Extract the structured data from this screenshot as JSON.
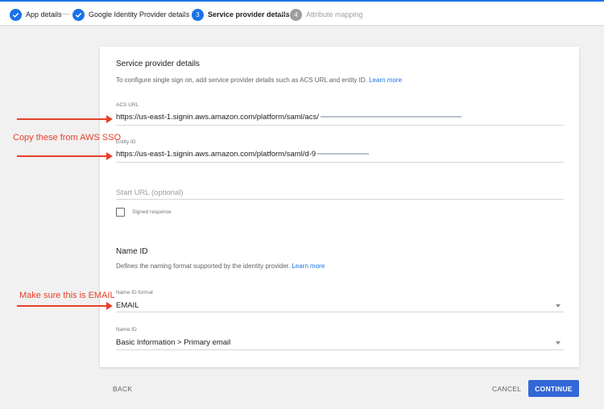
{
  "stepper": {
    "steps": [
      {
        "number": "1",
        "label": "App details",
        "state": "done"
      },
      {
        "number": "2",
        "label": "Google Identity Provider details",
        "state": "done"
      },
      {
        "number": "3",
        "label": "Service provider details",
        "state": "active"
      },
      {
        "number": "4",
        "label": "Attribute mapping",
        "state": "todo"
      }
    ]
  },
  "service_provider": {
    "title": "Service provider details",
    "description": "To configure single sign on, add service provider details such as ACS URL and entity ID.",
    "learn_more": "Learn more",
    "acs_url": {
      "label": "ACS URL",
      "value": "https://us-east-1.signin.aws.amazon.com/platform/saml/acs/"
    },
    "entity_id": {
      "label": "Entity ID",
      "value": "https://us-east-1.signin.aws.amazon.com/platform/saml/d-9"
    },
    "start_url": {
      "placeholder": "Start URL (optional)"
    },
    "signed_response": {
      "label": "Signed response",
      "checked": false
    }
  },
  "name_id": {
    "title": "Name ID",
    "description": "Defines the naming format supported by the identity provider.",
    "learn_more": "Learn more",
    "format": {
      "label": "Name ID format",
      "value": "EMAIL"
    },
    "name_id_field": {
      "label": "Name ID",
      "value": "Basic Information > Primary email"
    }
  },
  "annotations": {
    "copy_from_sso": "Copy these from AWS SSO",
    "make_sure_email": "Make sure this is EMAIL"
  },
  "footer": {
    "back": "BACK",
    "cancel": "CANCEL",
    "continue": "CONTINUE"
  },
  "colors": {
    "accent": "#1a73e8",
    "annotation": "#e8412c",
    "continue_button": "#3367d6"
  }
}
